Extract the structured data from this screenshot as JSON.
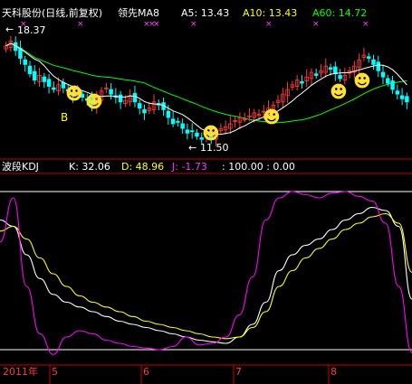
{
  "price_panel": {
    "stock_name": "天科股份(日线,前复权)",
    "indicator_name": "领先MA8",
    "ma5_label": "A5: 13.43",
    "ma10_label": "A10: 13.43",
    "ma60_label": "A60: 14.72",
    "high_label": "18.37",
    "low_label": "11.50",
    "signal_label": "B",
    "smiley_glyph": "☻"
  },
  "kdj_panel": {
    "name": "波段KDJ",
    "k_label": "K: 32.06",
    "d_label": "D: 48.96",
    "j_label": "J: -1.73",
    "levels_label": ": 100.00 : 0.00"
  },
  "time_axis": {
    "labels": [
      "2011年",
      "5",
      "6",
      "7",
      "8"
    ]
  },
  "colors": {
    "background": "#000000",
    "up_candle": "#ff3b3b",
    "down_candle": "#00ffff",
    "ma_short": "#ffffff",
    "ma_long": "#00ff00",
    "kdj_k": "#ffffff",
    "kdj_d": "#ffff00",
    "kdj_j": "#ff00ff",
    "label_default": "#ffffff",
    "label_yellow": "#ffff00",
    "label_green": "#00ff00",
    "label_magenta": "#ff33ff",
    "grid_red": "#cc0000",
    "smiley": "#ffe033"
  },
  "chart_data": [
    {
      "type": "candlestick",
      "title": "天科股份(日线,前复权)",
      "x_range": [
        "2011-04",
        "2011-08"
      ],
      "ylim": [
        11.0,
        19.0
      ],
      "annotations": [
        "18.37",
        "11.50",
        "B"
      ],
      "close": [
        17.8,
        18.1,
        17.5,
        17.0,
        16.6,
        16.0,
        15.6,
        15.9,
        15.5,
        15.2,
        15.0,
        15.3,
        15.1,
        14.9,
        14.6,
        14.8,
        14.5,
        14.3,
        14.0,
        14.4,
        14.9,
        15.1,
        14.7,
        14.5,
        14.2,
        14.3,
        14.6,
        14.2,
        13.8,
        13.5,
        13.8,
        14.2,
        14.0,
        13.7,
        13.2,
        12.8,
        12.9,
        12.5,
        12.2,
        12.3,
        12.0,
        11.8,
        12.1,
        11.9,
        12.2,
        12.5,
        12.6,
        12.8,
        13.0,
        13.2,
        13.1,
        13.3,
        13.5,
        13.4,
        13.6,
        13.8,
        14.0,
        14.3,
        14.7,
        15.0,
        15.3,
        15.6,
        15.4,
        15.8,
        16.1,
        15.9,
        16.2,
        16.5,
        16.3,
        16.0,
        15.7,
        15.9,
        16.2,
        16.5,
        16.9,
        17.2,
        17.0,
        16.6,
        16.2,
        15.8,
        15.4,
        15.0,
        14.7,
        14.4,
        14.2
      ],
      "series": [
        {
          "name": "A5",
          "last": 13.43
        },
        {
          "name": "A10",
          "last": 13.43
        },
        {
          "name": "A60",
          "last": 14.72
        }
      ]
    },
    {
      "type": "line",
      "title": "波段KDJ",
      "ylim": [
        0,
        100
      ],
      "reference_lines": [
        100,
        0
      ],
      "series": [
        {
          "name": "K",
          "last": 32.06,
          "values": [
            82,
            78,
            60,
            45,
            35,
            30,
            27,
            24,
            21,
            18,
            16,
            14,
            12,
            10,
            8,
            6,
            5,
            4,
            8,
            16,
            30,
            50,
            60,
            66,
            70,
            76,
            82,
            86,
            90,
            88,
            78,
            32
          ]
        },
        {
          "name": "D",
          "last": 48.96,
          "values": [
            75,
            78,
            70,
            58,
            48,
            40,
            34,
            30,
            27,
            24,
            21,
            18,
            16,
            14,
            12,
            10,
            8,
            7,
            8,
            14,
            24,
            40,
            50,
            58,
            64,
            70,
            76,
            80,
            84,
            86,
            80,
            49
          ]
        },
        {
          "name": "J",
          "last": -1.73,
          "values": [
            68,
            96,
            40,
            10,
            -3,
            8,
            12,
            10,
            6,
            4,
            2,
            1,
            0,
            2,
            8,
            3,
            4,
            8,
            22,
            46,
            82,
            96,
            100,
            98,
            96,
            99,
            100,
            97,
            94,
            80,
            40,
            -1.73
          ]
        }
      ]
    }
  ]
}
